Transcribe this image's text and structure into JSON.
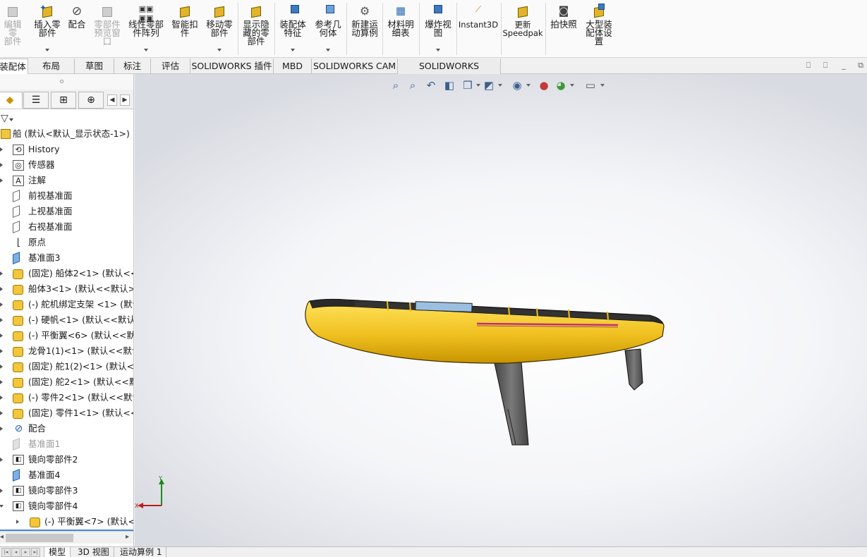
{
  "ribbon": {
    "buttons": [
      {
        "id": "edit",
        "label": "编辑零\n部件",
        "disabled": true,
        "icon": "edit-part-icon"
      },
      {
        "id": "insert",
        "label": "插入零\n部件",
        "disabled": false,
        "icon": "insert-components-icon"
      },
      {
        "id": "mate",
        "label": "配合",
        "disabled": false,
        "icon": "mate-icon"
      },
      {
        "id": "preview",
        "label": "零部件\n预览窗\n口",
        "disabled": true,
        "icon": "component-preview-icon"
      },
      {
        "id": "linear",
        "label": "线性零部\n件阵列",
        "disabled": false,
        "icon": "linear-pattern-icon"
      },
      {
        "id": "smart",
        "label": "智能扣\n件",
        "disabled": false,
        "icon": "smart-fasteners-icon"
      },
      {
        "id": "move",
        "label": "移动零\n部件",
        "disabled": false,
        "icon": "move-component-icon"
      },
      {
        "id": "showhide",
        "label": "显示隐\n藏的零\n部件",
        "disabled": false,
        "icon": "show-hidden-icon"
      },
      {
        "id": "asmfeat",
        "label": "装配体\n特征",
        "disabled": false,
        "icon": "assembly-features-icon"
      },
      {
        "id": "refgeo",
        "label": "参考几\n何体",
        "disabled": false,
        "icon": "reference-geometry-icon"
      },
      {
        "id": "motion",
        "label": "新建运\n动算例",
        "disabled": false,
        "icon": "new-motion-study-icon"
      },
      {
        "id": "bom",
        "label": "材料明\n细表",
        "disabled": false,
        "icon": "bom-icon"
      },
      {
        "id": "explode",
        "label": "爆炸视\n图",
        "disabled": false,
        "icon": "exploded-view-icon"
      },
      {
        "id": "instant3d",
        "label": "Instant3D",
        "disabled": false,
        "icon": "instant3d-icon"
      },
      {
        "id": "speedpak",
        "label": "更新\nSpeedpak",
        "disabled": false,
        "icon": "speedpak-icon"
      },
      {
        "id": "snapshot",
        "label": "拍快照",
        "disabled": false,
        "icon": "camera-icon"
      },
      {
        "id": "largeasm",
        "label": "大型装\n配体设\n置",
        "disabled": false,
        "icon": "large-assembly-icon"
      }
    ]
  },
  "tabs": [
    "装配体",
    "布局",
    "草图",
    "标注",
    "评估",
    "SOLIDWORKS 插件",
    "MBD",
    "SOLIDWORKS CAM",
    "SOLIDWORKS Inspection"
  ],
  "tree": {
    "root": "船 (默认<默认_显示状态-1>)",
    "items": [
      {
        "label": "History",
        "icon": "history-icon",
        "muted": false
      },
      {
        "label": "传感器",
        "icon": "sensor-icon",
        "muted": false
      },
      {
        "label": "注解",
        "icon": "annotation-icon",
        "muted": false
      },
      {
        "label": "前视基准面",
        "icon": "plane-icon",
        "muted": false
      },
      {
        "label": "上视基准面",
        "icon": "plane-icon",
        "muted": false
      },
      {
        "label": "右视基准面",
        "icon": "plane-icon",
        "muted": false
      },
      {
        "label": "原点",
        "icon": "origin-icon",
        "muted": false
      },
      {
        "label": "基准面3",
        "icon": "plane-blue-icon",
        "muted": false
      },
      {
        "label": "(固定) 船体2<1> (默认<<默",
        "icon": "part-icon",
        "muted": false
      },
      {
        "label": "船体3<1> (默认<<默认>_显",
        "icon": "part-icon",
        "muted": false
      },
      {
        "label": "(-) 舵机绑定支架 <1> (默认",
        "icon": "part-icon",
        "muted": false
      },
      {
        "label": "(-) 硬帆<1> (默认<<默认>_",
        "icon": "part-icon",
        "muted": false
      },
      {
        "label": "(-) 平衡翼<6> (默认<<默认",
        "icon": "part-icon",
        "muted": false
      },
      {
        "label": "龙骨1(1)<1> (默认<<默认",
        "icon": "part-icon",
        "muted": false
      },
      {
        "label": "(固定) 舵1(2)<1> (默认<<默",
        "icon": "part-icon",
        "muted": false
      },
      {
        "label": "(固定) 舵2<1> (默认<<默认",
        "icon": "part-icon",
        "muted": false
      },
      {
        "label": "(-) 零件2<1> (默认<<默认",
        "icon": "part-icon",
        "muted": false
      },
      {
        "label": "(固定) 零件1<1> (默认<<默",
        "icon": "part-icon",
        "muted": false
      },
      {
        "label": "配合",
        "icon": "mates-icon",
        "muted": false
      },
      {
        "label": "基准面1",
        "icon": "plane-gray-icon",
        "muted": true
      },
      {
        "label": "镜向零部件2",
        "icon": "mirror-icon",
        "muted": false
      },
      {
        "label": "基准面4",
        "icon": "plane-blue-icon",
        "muted": false
      },
      {
        "label": "镜向零部件3",
        "icon": "mirror-icon",
        "muted": false
      },
      {
        "label": "镜向零部件4",
        "icon": "mirror-icon",
        "muted": false
      },
      {
        "label": "(-) 平衡翼<7> (默认<<",
        "icon": "part-icon",
        "muted": false
      }
    ]
  },
  "bottom_tabs": [
    "模型",
    "3D 视图",
    "运动算例 1"
  ],
  "triad": {
    "y_label": "Y",
    "x_label": "X"
  },
  "colors": {
    "hull": "#f0c020",
    "hull_shadow": "#c89400",
    "keel": "#5a5a5a",
    "deck": "#2a2a2a",
    "stripe": "#c0307a",
    "accent": "#1f5fa8"
  }
}
